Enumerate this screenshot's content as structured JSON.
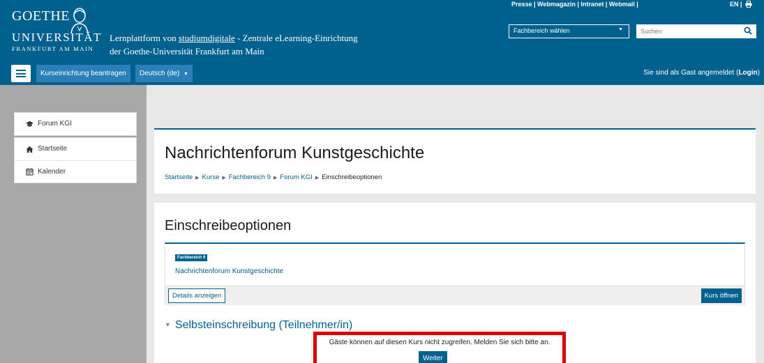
{
  "header": {
    "logo": {
      "line1": "GOETHE",
      "line2": "UNIVERSITÄT",
      "line3": "FRANKFURT AM MAIN"
    },
    "tagline_prefix": "Lernplattform von ",
    "tagline_link": "studiumdigitale",
    "tagline_suffix": " - Zentrale eLearning-Einrichtung der Goethe-Universität Frankfurt am Main",
    "toplinks": "Presse | Webmagazin | Intranet | Webmail |",
    "lang": "EN |",
    "fachbereich_select": "Fachbereich wählen",
    "search_placeholder": "Suchen",
    "course_request_button": "Kurseinrichtung beantragen",
    "language_button": "Deutsch (de)",
    "guest_prefix": "Sie sind als Gast angemeldet (",
    "guest_login": "Login",
    "guest_suffix": ")"
  },
  "sidebar": {
    "course_item": "Forum KGI",
    "items": [
      {
        "label": "Startseite",
        "icon": "home-icon"
      },
      {
        "label": "Kalender",
        "icon": "calendar-icon"
      }
    ]
  },
  "page": {
    "title": "Nachrichtenforum Kunstgeschichte",
    "breadcrumb": [
      "Startseite",
      "Kurse",
      "Fachbereich 9",
      "Forum KGI",
      "Einschreibeoptionen"
    ]
  },
  "enrol": {
    "heading": "Einschreibeoptionen",
    "badge": "Fachbereich 9",
    "course_name": "Nachrichtenforum Kunstgeschichte",
    "details_button": "Details anzeigen",
    "open_button": "Kurs öffnen",
    "section_title": "Selbsteinschreibung (Teilnehmer/in)"
  },
  "notice": {
    "message": "Gäste können auf diesen Kurs nicht zugreifen. Melden Sie sich bitte an.",
    "button": "Weiter"
  },
  "colors": {
    "brand": "#00618f",
    "button_blue": "#2a7fb8",
    "highlight": "#e00000"
  }
}
